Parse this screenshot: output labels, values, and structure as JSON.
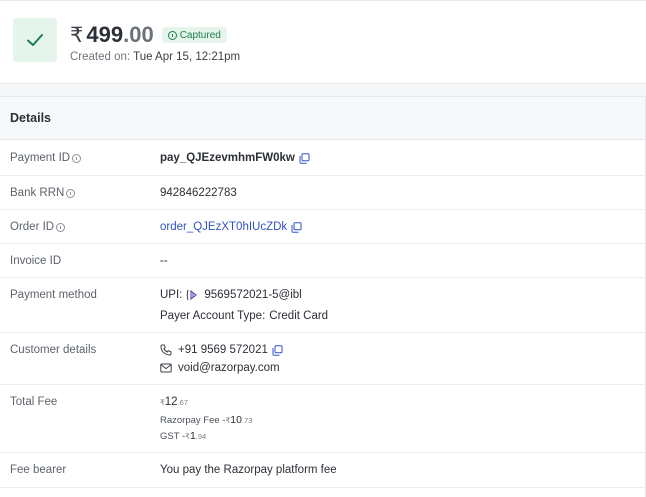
{
  "payment": {
    "currency_symbol": "₹",
    "amount_int": "499",
    "amount_dec": ".00",
    "status": "Captured",
    "created_label": "Created on:",
    "created_value": "Tue Apr 15, 12:21pm"
  },
  "details": {
    "title": "Details",
    "payment_id_label": "Payment ID",
    "payment_id": "pay_QJEzevmhmFW0kw",
    "bank_rrn_label": "Bank RRN",
    "bank_rrn": "942846222783",
    "order_id_label": "Order ID",
    "order_id": "order_QJEzXT0hIUcZDk",
    "invoice_id_label": "Invoice ID",
    "invoice_id": "--",
    "payment_method_label": "Payment method",
    "upi_prefix": "UPI:",
    "upi_id": "9569572021-5@ibl",
    "payer_account_label": "Payer Account Type:",
    "payer_account_value": "Credit Card",
    "customer_details_label": "Customer details",
    "phone": "+91 9569 572021",
    "email": "void@razorpay.com",
    "total_fee_label": "Total Fee",
    "total_fee_symbol": "₹",
    "total_fee_int": "12",
    "total_fee_dec": ".67",
    "razorpay_fee_label": "Razorpay Fee - ",
    "razorpay_fee_symbol": "₹",
    "razorpay_fee_int": "10",
    "razorpay_fee_dec": ".73",
    "gst_label": "GST - ",
    "gst_symbol": "₹",
    "gst_int": "1",
    "gst_dec": ".94",
    "fee_bearer_label": "Fee bearer",
    "fee_bearer": "You pay the Razorpay platform fee"
  },
  "colors": {
    "success": "#1b7f4b",
    "link": "#2f52c6"
  }
}
